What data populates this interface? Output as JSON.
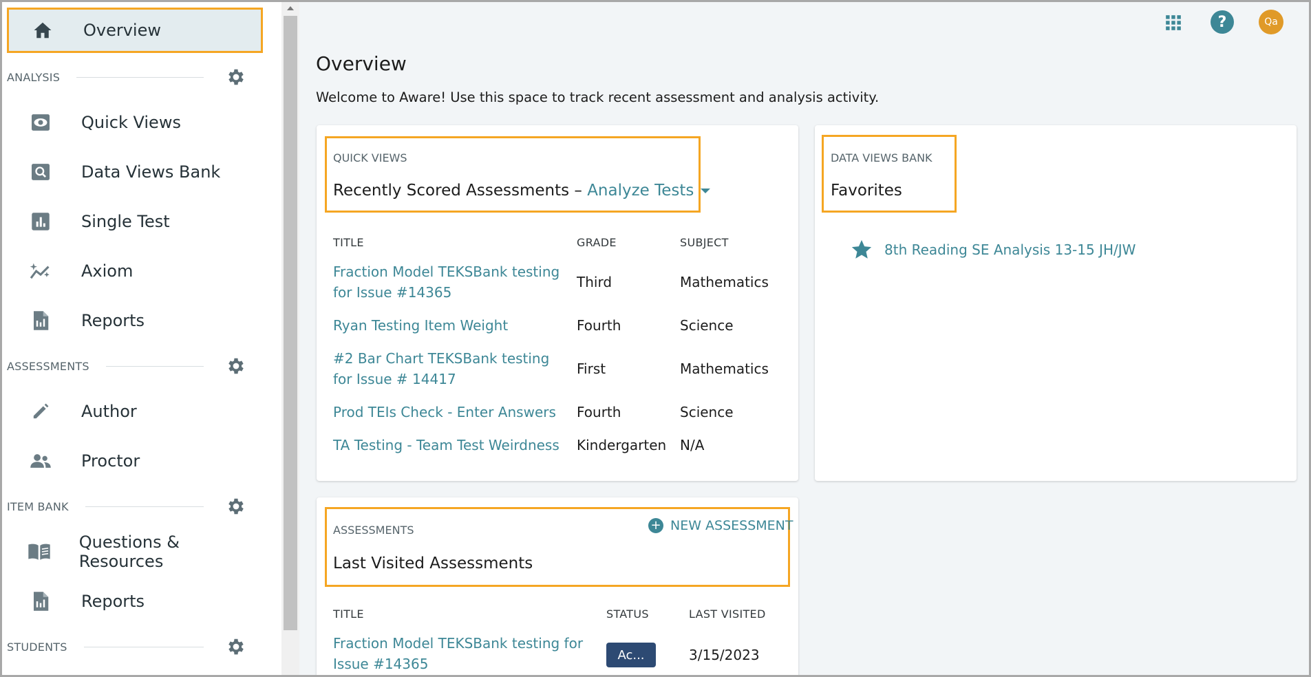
{
  "sidebar": {
    "overview": "Overview",
    "sections": {
      "analysis": "ANALYSIS",
      "assessments": "ASSESSMENTS",
      "item_bank": "ITEM BANK",
      "students": "STUDENTS"
    },
    "analysis_items": [
      "Quick Views",
      "Data Views Bank",
      "Single Test",
      "Axiom",
      "Reports"
    ],
    "assessment_items": [
      "Author",
      "Proctor"
    ],
    "item_bank_items": [
      "Questions & Resources",
      "Reports"
    ]
  },
  "topbar": {
    "icons": [
      "apps-grid-icon",
      "help-icon"
    ],
    "avatar_initials": "Qa"
  },
  "page": {
    "title": "Overview",
    "welcome": "Welcome to Aware! Use this space to track recent assessment and analysis activity."
  },
  "quick_views": {
    "tag": "QUICK VIEWS",
    "heading": "Recently Scored Assessments –",
    "dropdown": "Analyze Tests",
    "columns": [
      "TITLE",
      "GRADE",
      "SUBJECT"
    ],
    "rows": [
      {
        "title": "Fraction Model TEKSBank testing for Issue #14365",
        "grade": "Third",
        "subject": "Mathematics"
      },
      {
        "title": "Ryan Testing Item Weight",
        "grade": "Fourth",
        "subject": "Science"
      },
      {
        "title": "#2 Bar Chart TEKSBank testing for Issue # 14417",
        "grade": "First",
        "subject": "Mathematics"
      },
      {
        "title": "Prod TEIs Check - Enter Answers",
        "grade": "Fourth",
        "subject": "Science"
      },
      {
        "title": "TA Testing - Team Test Weirdness",
        "grade": "Kindergarten",
        "subject": "N/A"
      }
    ]
  },
  "data_views_bank": {
    "tag": "DATA VIEWS BANK",
    "heading": "Favorites",
    "favorites": [
      "8th Reading SE Analysis 13-15 JH/JW"
    ]
  },
  "assessments": {
    "tag": "ASSESSMENTS",
    "new_button": "NEW ASSESSMENT",
    "heading": "Last Visited Assessments",
    "columns": [
      "TITLE",
      "STATUS",
      "LAST VISITED"
    ],
    "rows": [
      {
        "title": "Fraction Model TEKSBank testing for Issue #14365",
        "status": "Ac...",
        "last_visited": "3/15/2023"
      }
    ]
  },
  "colors": {
    "accent": "#3d8796",
    "highlight": "#f5a623",
    "badge": "#2d4a73",
    "avatar": "#e09a28"
  }
}
